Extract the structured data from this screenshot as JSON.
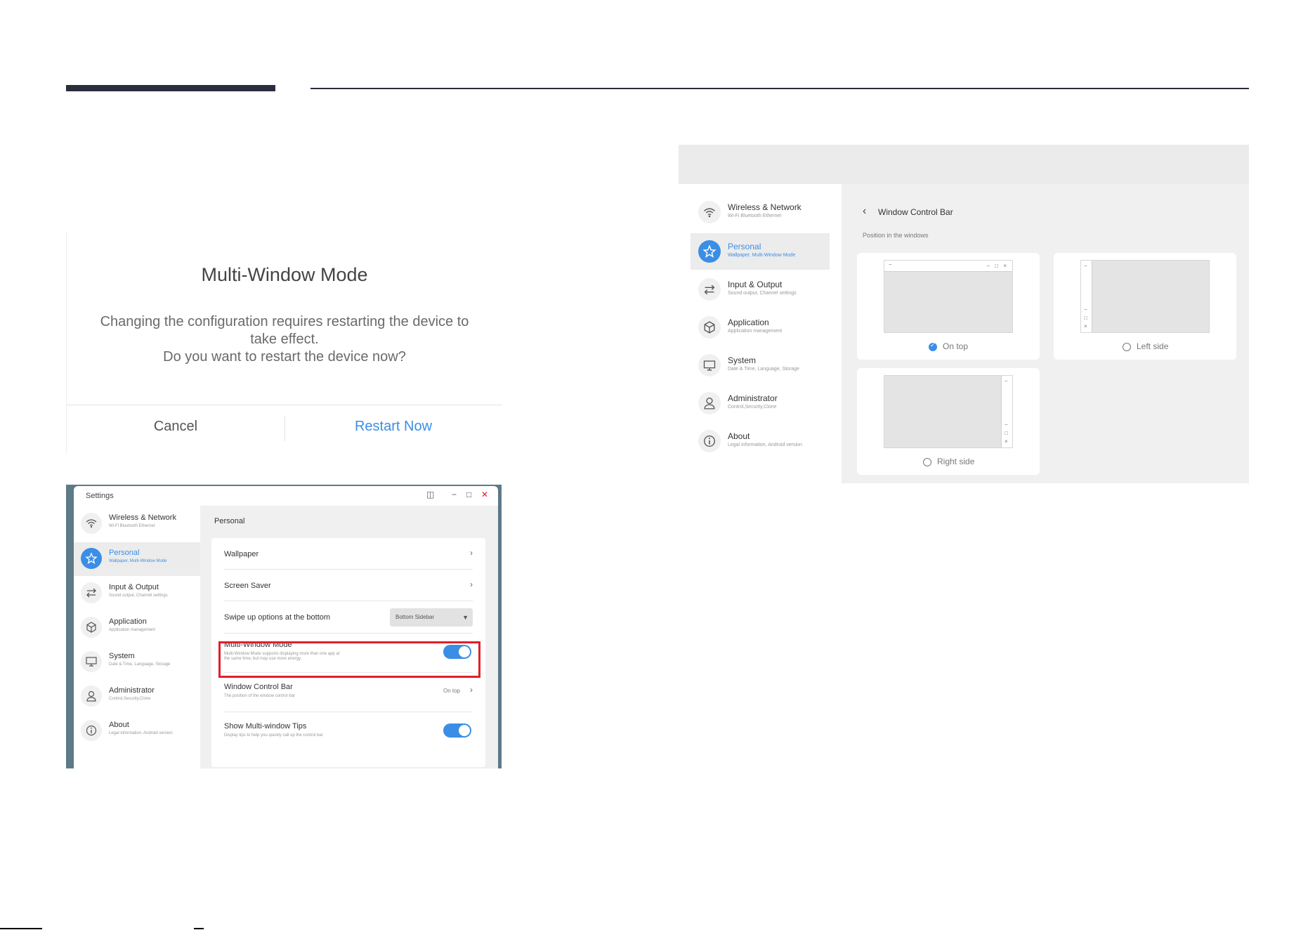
{
  "dialog": {
    "title": "Multi-Window Mode",
    "message_line1": "Changing the configuration requires restarting the device to",
    "message_line2": "take effect.",
    "message_line3": "Do you want to restart the device now?",
    "cancel_label": "Cancel",
    "restart_label": "Restart Now"
  },
  "settings_window": {
    "title": "Settings",
    "content_heading": "Personal",
    "sidebar": [
      {
        "label": "Wireless & Network",
        "sub": "Wi-Fi Bluetooth Ethernet",
        "icon": "wifi-icon"
      },
      {
        "label": "Personal",
        "sub": "Wallpaper, Multi-Window Mode",
        "icon": "star-icon",
        "active": true
      },
      {
        "label": "Input & Output",
        "sub": "Sound output, Channel settings",
        "icon": "swap-icon"
      },
      {
        "label": "Application",
        "sub": "Application management",
        "icon": "cube-icon"
      },
      {
        "label": "System",
        "sub": "Date & Time, Language, Storage",
        "icon": "monitor-icon"
      },
      {
        "label": "Administrator",
        "sub": "Control,Security,Clone",
        "icon": "person-icon"
      },
      {
        "label": "About",
        "sub": "Legal information, Android version",
        "icon": "info-icon"
      }
    ],
    "rows": {
      "wallpaper": "Wallpaper",
      "screen_saver": "Screen Saver",
      "swipe_up": "Swipe up options at the bottom",
      "swipe_up_value": "Bottom Sidebar",
      "multi_window": "Multi-Window Mode",
      "multi_window_sub1": "Multi-Window Mode supports displaying more than one app at",
      "multi_window_sub2": "the same time, but may use more energy.",
      "multi_window_on": true,
      "wcb": "Window Control Bar",
      "wcb_sub": "The position of the window control bar",
      "wcb_value": "On top",
      "tips": "Show Multi-window Tips",
      "tips_sub": "Display tips to help you quickly call up the control bar",
      "tips_on": true
    }
  },
  "window_control_bar": {
    "title": "Window Control Bar",
    "subtitle": "Position in the windows",
    "options": [
      {
        "label": "On top",
        "selected": true
      },
      {
        "label": "Left side",
        "selected": false
      },
      {
        "label": "Right side",
        "selected": false
      }
    ],
    "sidebar": [
      {
        "label": "Wireless & Network",
        "sub": "Wi-Fi Bluetooth Ethernet"
      },
      {
        "label": "Personal",
        "sub": "Wallpaper, Multi-Window Mode"
      },
      {
        "label": "Input & Output",
        "sub": "Sound output, Channel settings"
      },
      {
        "label": "Application",
        "sub": "Application management"
      },
      {
        "label": "System",
        "sub": "Date & Time, Language, Storage"
      },
      {
        "label": "Administrator",
        "sub": "Control,Security,Clone"
      },
      {
        "label": "About",
        "sub": "Legal information, Android version"
      }
    ]
  },
  "colors": {
    "accent": "#3a8ee6",
    "highlight": "#e0202a",
    "rule": "#2b2d3e"
  }
}
